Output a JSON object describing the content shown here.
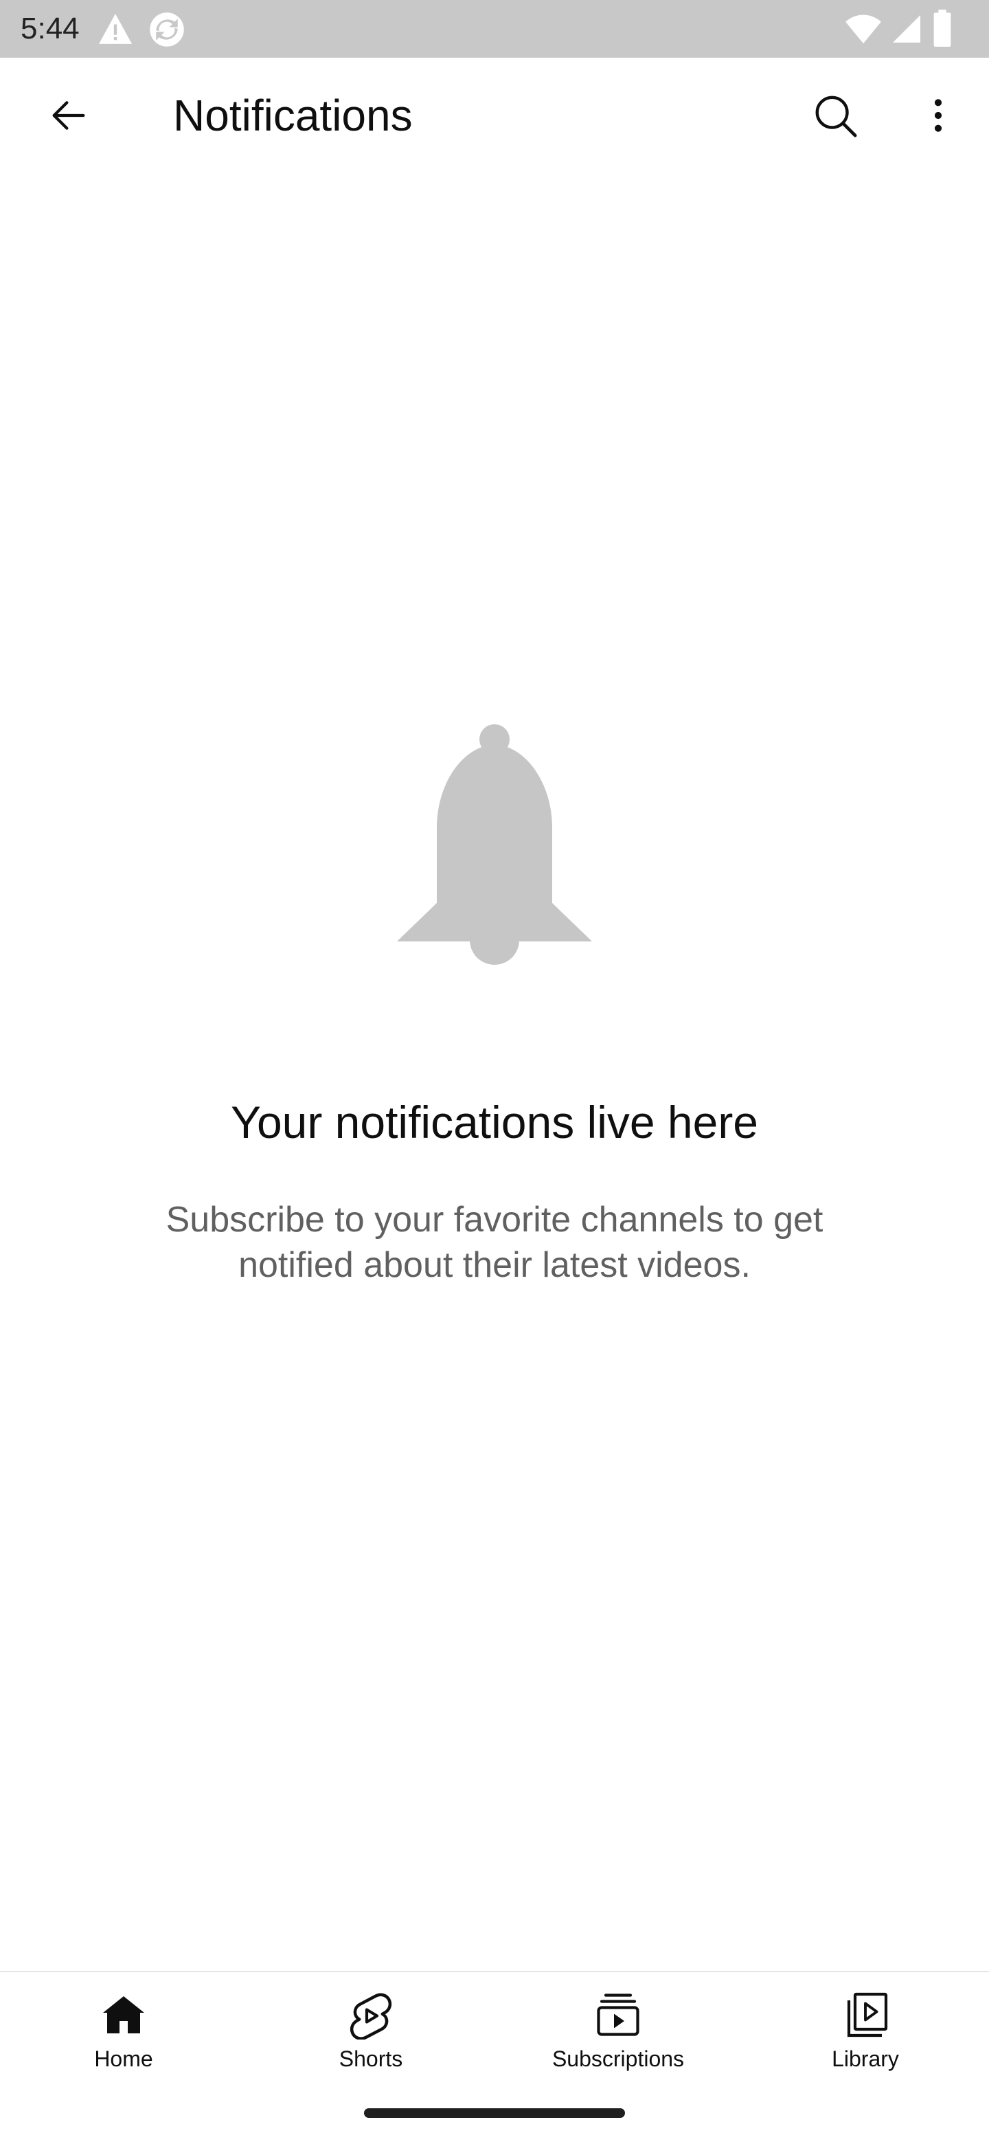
{
  "status_bar": {
    "time": "5:44",
    "icons": [
      "warning-icon",
      "sync-icon",
      "wifi-icon",
      "signal-icon",
      "battery-icon"
    ]
  },
  "app_bar": {
    "title": "Notifications",
    "back_icon": "arrow-back-icon",
    "search_icon": "search-icon",
    "more_icon": "more-vert-icon"
  },
  "empty_state": {
    "icon": "bell-icon",
    "heading": "Your notifications live here",
    "subtext": "Subscribe to your favorite channels to get notified about their latest videos."
  },
  "bottom_nav": {
    "items": [
      {
        "label": "Home",
        "icon": "home-icon",
        "selected": true
      },
      {
        "label": "Shorts",
        "icon": "shorts-icon",
        "selected": false
      },
      {
        "label": "Subscriptions",
        "icon": "subscriptions-icon",
        "selected": false
      },
      {
        "label": "Library",
        "icon": "library-icon",
        "selected": false
      }
    ]
  },
  "colors": {
    "status_bar_bg": "#c8c8c8",
    "text_primary": "#0f0f0f",
    "text_secondary": "#606060",
    "bell_gray": "#c6c6c6"
  }
}
